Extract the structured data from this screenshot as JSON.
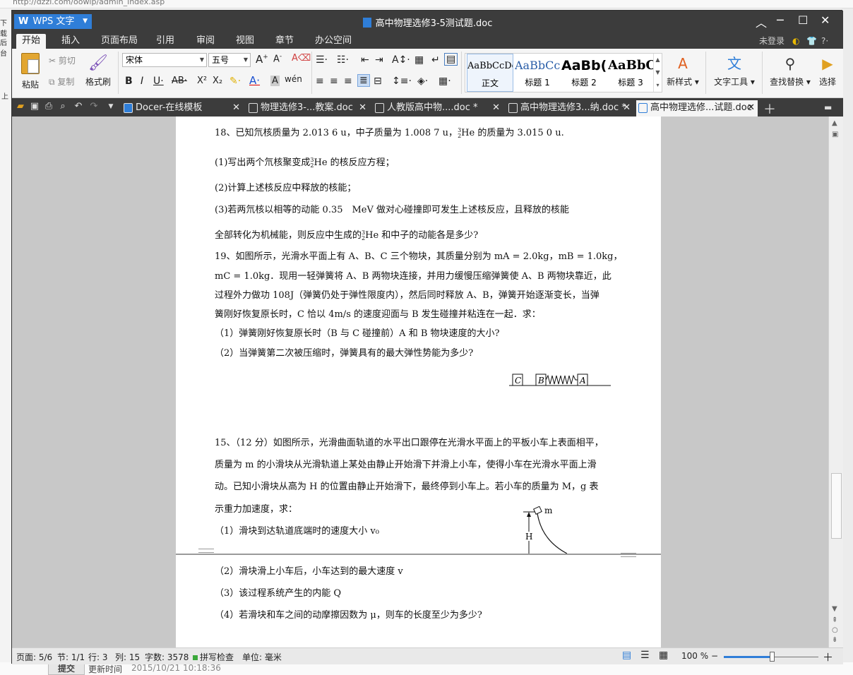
{
  "background": {
    "url": "http://dzzl.com/oowlp/admin_index.asp",
    "left_text_1": "下载",
    "left_text_2": "后台",
    "left_text_3": "上",
    "submit": "提交",
    "update_label": "更新时间",
    "update_time": "2015/10/21 10:18:36"
  },
  "app": {
    "wps_label": "WPS 文字",
    "doc_title": "高中物理选修3-5测试题.doc",
    "user": "未登录"
  },
  "menu": [
    "开始",
    "插入",
    "页面布局",
    "引用",
    "审阅",
    "视图",
    "章节",
    "办公空间"
  ],
  "ribbon": {
    "paste": "粘贴",
    "cut": "剪切",
    "copy": "复制",
    "format_painter": "格式刷",
    "font": "宋体",
    "size": "五号",
    "styles": [
      {
        "preview": "AaBbCcDc",
        "label": "正文"
      },
      {
        "preview": "AaBbCc",
        "label": "标题 1"
      },
      {
        "preview": "AaBb(",
        "label": "标题 2"
      },
      {
        "preview": "AaBbC",
        "label": "标题 3"
      }
    ],
    "new_style": "新样式",
    "text_tools": "文字工具",
    "find_replace": "查找替换",
    "select": "选择"
  },
  "tabs": [
    {
      "label": "Docer-在线模板"
    },
    {
      "label": "物理选修3-...教案.doc"
    },
    {
      "label": "人教版高中物....doc *"
    },
    {
      "label": "高中物理选修3...纳.doc *"
    },
    {
      "label": "高中物理选修...试题.doc"
    }
  ],
  "document": {
    "p18_a": "18、已知氘核质量为 2.013 6 u，中子质量为 1.008 7 u，",
    "p18_b": "He 的质量为 3.015 0 u.",
    "p18_1a": "(1)写出两个氘核聚变成",
    "p18_1b": "He 的核反应方程；",
    "p18_2": "(2)计算上述核反应中释放的核能；",
    "p18_3": "(3)若两氘核以相等的动能 0.35　MeV 做对心碰撞即可发生上述核反应，且释放的核能",
    "p18_4a": "全部转化为机械能，则反应中生成的",
    "p18_4b": "He 和中子的动能各是多少?",
    "p19_1": "19、如图所示，光滑水平面上有 A、B、C 三个物块，其质量分别为 mA = 2.0kg，mB = 1.0kg，",
    "p19_2": "mC = 1.0kg．现用一轻弹簧将 A、B 两物块连接，并用力缓慢压缩弹簧使 A、B 两物块靠近，此",
    "p19_3": "过程外力做功 108J（弹簧仍处于弹性限度内），然后同时释放 A、B，弹簧开始逐渐变长，当弹",
    "p19_4": "簧刚好恢复原长时，C 恰以 4m/s 的速度迎面与 B 发生碰撞并粘连在一起．求：",
    "p19_q1": "（1）弹簧刚好恢复原长时（B 与 C 碰撞前）A 和 B 物块速度的大小?",
    "p19_q2": "（2）当弹簧第二次被压缩时，弹簧具有的最大弹性势能为多少?",
    "fig19": {
      "c": "C",
      "b": "B",
      "a": "A"
    },
    "p15_1": "15、（12 分）如图所示，光滑曲面轨道的水平出口跟停在光滑水平面上的平板小车上表面相平，",
    "p15_2": "质量为 m 的小滑块从光滑轨道上某处由静止开始滑下并滑上小车，使得小车在光滑水平面上滑",
    "p15_3": "动。已知小滑块从高为 H 的位置由静止开始滑下，最终停到小车上。若小车的质量为 M，g 表",
    "p15_4": "示重力加速度，求：",
    "p15_q1": "（1）滑块到达轨道底端时的速度大小 v₀",
    "fig15": {
      "m": "m",
      "h": "H"
    },
    "p15_q2": "（2）滑块滑上小车后，小车达到的最大速度 v",
    "p15_q3": "（3）该过程系统产生的内能 Q",
    "p15_q4": "（4）若滑块和车之间的动摩擦因数为 μ，则车的长度至少为多少?",
    "sup3": "3",
    "sub2": "2"
  },
  "status": {
    "page": "页面: 5/6",
    "section": "节: 1/1",
    "row": "行: 3",
    "col": "列: 15",
    "words": "字数: 3578",
    "spell": "拼写检查",
    "unit": "单位: 毫米",
    "zoom": "100 %",
    "zoom_level": 0.5
  },
  "colors": {
    "accent": "#2f7ed8",
    "titlebar": "#3c3c3c"
  }
}
